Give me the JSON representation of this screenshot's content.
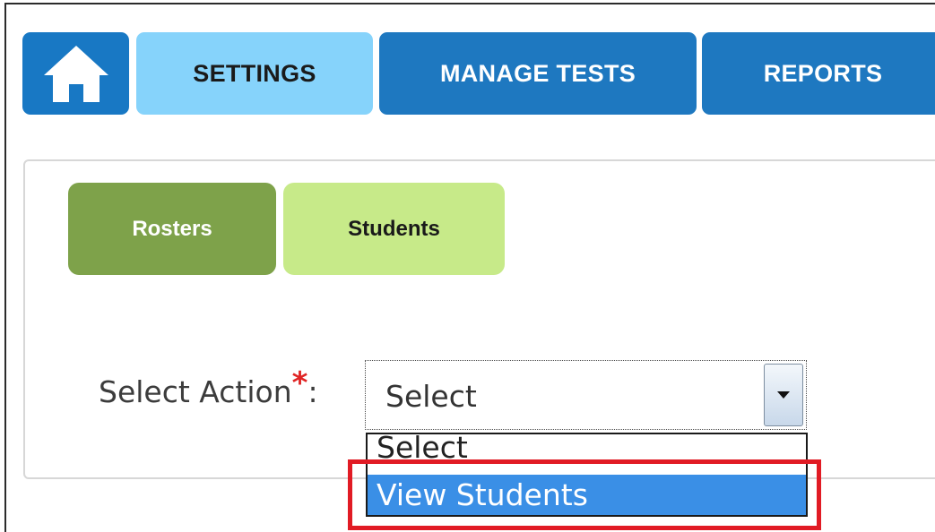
{
  "nav": {
    "home_icon": "home-icon",
    "tabs": [
      {
        "label": "SETTINGS",
        "active": true
      },
      {
        "label": "MANAGE TESTS",
        "active": false
      },
      {
        "label": "REPORTS",
        "active": false
      }
    ]
  },
  "subnav": {
    "tabs": [
      {
        "label": "Rosters",
        "active": false
      },
      {
        "label": "Students",
        "active": true
      }
    ]
  },
  "form": {
    "action_label": "Select Action",
    "required_marker": "*",
    "label_suffix": ":",
    "select_value": "Select",
    "options": [
      "Select",
      "View Students"
    ],
    "highlighted_option": "View Students"
  },
  "colors": {
    "nav_blue": "#1e78c0",
    "nav_active": "#86d3fb",
    "subtab_dark": "#7ea24a",
    "subtab_light": "#c7ea89",
    "option_highlight": "#3a8fe6",
    "callout_red": "#e11b24",
    "required_red": "#e02424"
  }
}
